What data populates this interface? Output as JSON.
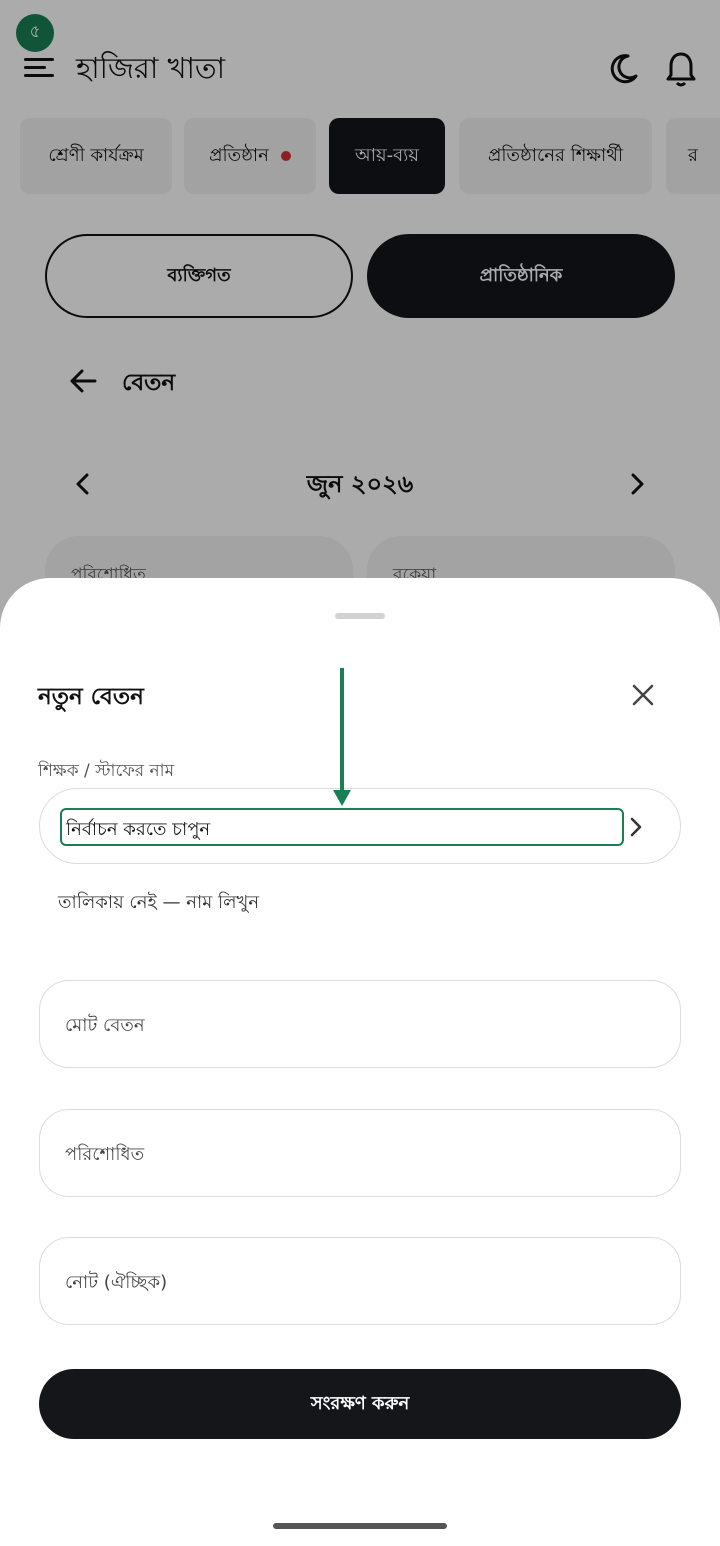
{
  "status": {
    "step_badge": "৫"
  },
  "header": {
    "title": "হাজিরা খাতা",
    "icons": [
      "menu-icon",
      "moon-icon",
      "bell-icon"
    ]
  },
  "tabs": [
    {
      "label": "শ্রেণী কার্যক্রম",
      "active": false,
      "has_dot": false
    },
    {
      "label": "প্রতিষ্ঠান",
      "active": false,
      "has_dot": true
    },
    {
      "label": "আয়-ব্যয়",
      "active": true,
      "has_dot": false
    },
    {
      "label": "প্রতিষ্ঠানের শিক্ষার্থী",
      "active": false,
      "has_dot": false
    },
    {
      "label": "র",
      "active": false,
      "has_dot": false
    }
  ],
  "segment": {
    "personal": "ব্যক্তিগত",
    "institutional": "প্রাতিষ্ঠানিক",
    "selected": "institutional"
  },
  "section": {
    "title": "বেতন"
  },
  "month": {
    "label": "জুন ২০২৬"
  },
  "cards": {
    "paid": "পরিশোধিত",
    "due": "বকেয়া"
  },
  "sheet": {
    "title": "নতুন বেতন",
    "staff_label": "শিক্ষক / স্টাফের নাম",
    "staff_placeholder": "নির্বাচন করতে চাপুন",
    "manual_entry": "তালিকায় নেই — নাম লিখুন",
    "total_salary": "মোট বেতন",
    "paid": "পরিশোধিত",
    "note": "নোট (ঐচ্ছিক)",
    "save": "সংরক্ষণ করুন"
  },
  "colors": {
    "accent": "#1a7f55",
    "dark": "#14161a",
    "alert_dot": "#d32f2f"
  }
}
